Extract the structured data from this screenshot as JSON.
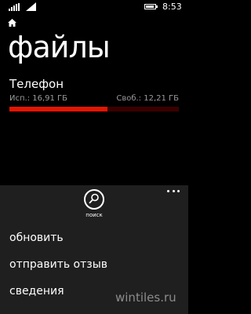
{
  "status_bar": {
    "time": "8:53",
    "signal_icon": "cellular-signal-icon",
    "wifi_icon": "wifi-icon",
    "battery_icon": "battery-icon",
    "battery_level": 0.9
  },
  "header": {
    "home_icon": "home-icon",
    "title": "файлы"
  },
  "storage": {
    "name": "Телефон",
    "used": "Исп.: 16,91 ГБ",
    "free": "Своб.: 12,21 ГБ",
    "used_fraction": 0.58,
    "colors": {
      "fill": "#e51400",
      "track": "#3b0000"
    }
  },
  "app_bar": {
    "background": "#1f1f1f",
    "more_icon": "more-ellipsis-icon",
    "search": {
      "icon": "search-icon",
      "label": "поиск"
    },
    "menu_items": [
      {
        "label": "обновить"
      },
      {
        "label": "отправить отзыв"
      },
      {
        "label": "сведения"
      }
    ]
  },
  "watermark": "wintiles.ru"
}
